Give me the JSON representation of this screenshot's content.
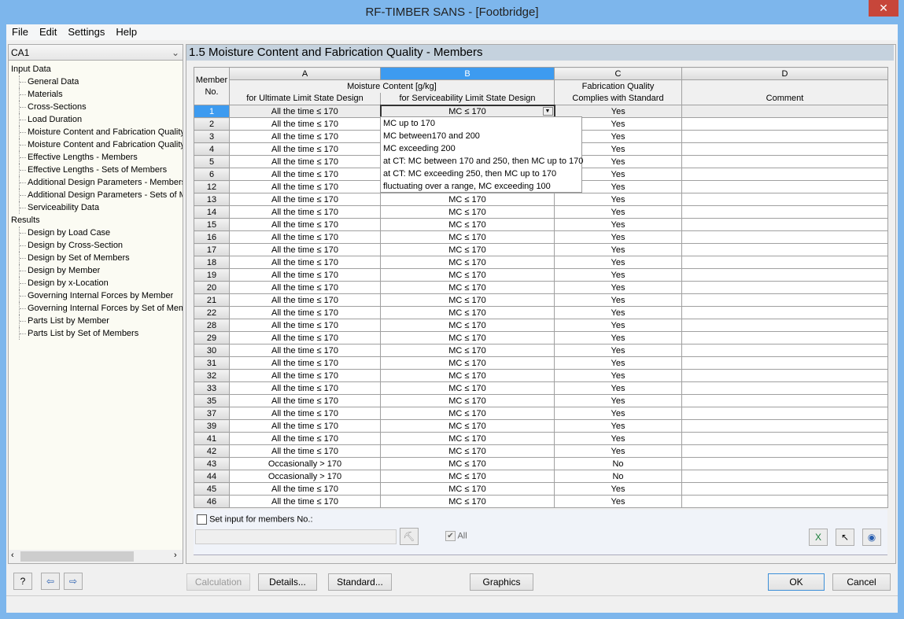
{
  "window": {
    "title": "RF-TIMBER SANS - [Footbridge]",
    "close": "✕"
  },
  "menu": [
    "File",
    "Edit",
    "Settings",
    "Help"
  ],
  "navigator": {
    "case": "CA1",
    "input_group": "Input Data",
    "input_items": [
      "General Data",
      "Materials",
      "Cross-Sections",
      "Load Duration",
      "Moisture Content and Fabrication Quality",
      "Moisture Content and Fabrication Quality",
      "Effective Lengths - Members",
      "Effective Lengths - Sets of Members",
      "Additional Design Parameters - Members",
      "Additional Design Parameters - Sets of Members",
      "Serviceability Data"
    ],
    "results_group": "Results",
    "results_items": [
      "Design by Load Case",
      "Design by Cross-Section",
      "Design by Set of Members",
      "Design by Member",
      "Design by x-Location",
      "Governing Internal Forces by Member",
      "Governing Internal Forces by Set of Members",
      "Parts List by Member",
      "Parts List by Set of Members"
    ]
  },
  "panel": {
    "title": "1.5 Moisture Content and Fabrication Quality - Members"
  },
  "table": {
    "col_letters": [
      "A",
      "B",
      "C",
      "D"
    ],
    "member_header": [
      "Member",
      "No."
    ],
    "moisture_header": "Moisture Content [g/kg]",
    "col_a": "for Ultimate Limit State Design",
    "col_b": "for Serviceability Limit State Design",
    "col_c": [
      "Fabrication Quality",
      "Complies with Standard"
    ],
    "col_d": "Comment",
    "rows": [
      [
        "1",
        "All the time ≤ 170",
        "MC ≤ 170",
        "Yes",
        ""
      ],
      [
        "2",
        "All the time ≤ 170",
        "MC ≤ 170",
        "Yes",
        ""
      ],
      [
        "3",
        "All the time ≤ 170",
        "MC ≤ 170",
        "Yes",
        ""
      ],
      [
        "4",
        "All the time ≤ 170",
        "MC ≤ 170",
        "Yes",
        ""
      ],
      [
        "5",
        "All the time ≤ 170",
        "MC ≤ 170",
        "Yes",
        ""
      ],
      [
        "6",
        "All the time ≤ 170",
        "MC ≤ 170",
        "Yes",
        ""
      ],
      [
        "12",
        "All the time ≤ 170",
        "MC ≤ 170",
        "Yes",
        ""
      ],
      [
        "13",
        "All the time ≤ 170",
        "MC ≤ 170",
        "Yes",
        ""
      ],
      [
        "14",
        "All the time ≤ 170",
        "MC ≤ 170",
        "Yes",
        ""
      ],
      [
        "15",
        "All the time ≤ 170",
        "MC ≤ 170",
        "Yes",
        ""
      ],
      [
        "16",
        "All the time ≤ 170",
        "MC ≤ 170",
        "Yes",
        ""
      ],
      [
        "17",
        "All the time ≤ 170",
        "MC ≤ 170",
        "Yes",
        ""
      ],
      [
        "18",
        "All the time ≤ 170",
        "MC ≤ 170",
        "Yes",
        ""
      ],
      [
        "19",
        "All the time ≤ 170",
        "MC ≤ 170",
        "Yes",
        ""
      ],
      [
        "20",
        "All the time ≤ 170",
        "MC ≤ 170",
        "Yes",
        ""
      ],
      [
        "21",
        "All the time ≤ 170",
        "MC ≤ 170",
        "Yes",
        ""
      ],
      [
        "22",
        "All the time ≤ 170",
        "MC ≤ 170",
        "Yes",
        ""
      ],
      [
        "28",
        "All the time ≤ 170",
        "MC ≤ 170",
        "Yes",
        ""
      ],
      [
        "29",
        "All the time ≤ 170",
        "MC ≤ 170",
        "Yes",
        ""
      ],
      [
        "30",
        "All the time ≤ 170",
        "MC ≤ 170",
        "Yes",
        ""
      ],
      [
        "31",
        "All the time ≤ 170",
        "MC ≤ 170",
        "Yes",
        ""
      ],
      [
        "32",
        "All the time ≤ 170",
        "MC ≤ 170",
        "Yes",
        ""
      ],
      [
        "33",
        "All the time ≤ 170",
        "MC ≤ 170",
        "Yes",
        ""
      ],
      [
        "35",
        "All the time ≤ 170",
        "MC ≤ 170",
        "Yes",
        ""
      ],
      [
        "37",
        "All the time ≤ 170",
        "MC ≤ 170",
        "Yes",
        ""
      ],
      [
        "39",
        "All the time ≤ 170",
        "MC ≤ 170",
        "Yes",
        ""
      ],
      [
        "41",
        "All the time ≤ 170",
        "MC ≤ 170",
        "Yes",
        ""
      ],
      [
        "42",
        "All the time ≤ 170",
        "MC ≤ 170",
        "Yes",
        ""
      ],
      [
        "43",
        "Occasionally > 170",
        "MC ≤ 170",
        "No",
        ""
      ],
      [
        "44",
        "Occasionally > 170",
        "MC ≤ 170",
        "No",
        ""
      ],
      [
        "45",
        "All the time ≤ 170",
        "MC ≤ 170",
        "Yes",
        ""
      ],
      [
        "46",
        "All the time ≤ 170",
        "MC ≤ 170",
        "Yes",
        ""
      ]
    ]
  },
  "dropdown_options": [
    "MC up to 170",
    "MC between170 and 200",
    "MC exceeding 200",
    "at CT: MC between 170 and 250, then MC up to 170",
    "at CT: MC exceeding 250, then MC up to 170",
    "fluctuating over a range, MC exceeding 100"
  ],
  "bottom": {
    "set_input_label": "Set input for members No.:",
    "set_input_checked": false,
    "members_value": "",
    "all_label": "All",
    "all_checked": true
  },
  "buttons": {
    "calculation": "Calculation",
    "details": "Details...",
    "standard": "Standard...",
    "graphics": "Graphics",
    "ok": "OK",
    "cancel": "Cancel"
  },
  "colors": {
    "selection": "#3d9bf0",
    "header_band": "#c5d2de",
    "window_frame": "#7db6ec"
  }
}
